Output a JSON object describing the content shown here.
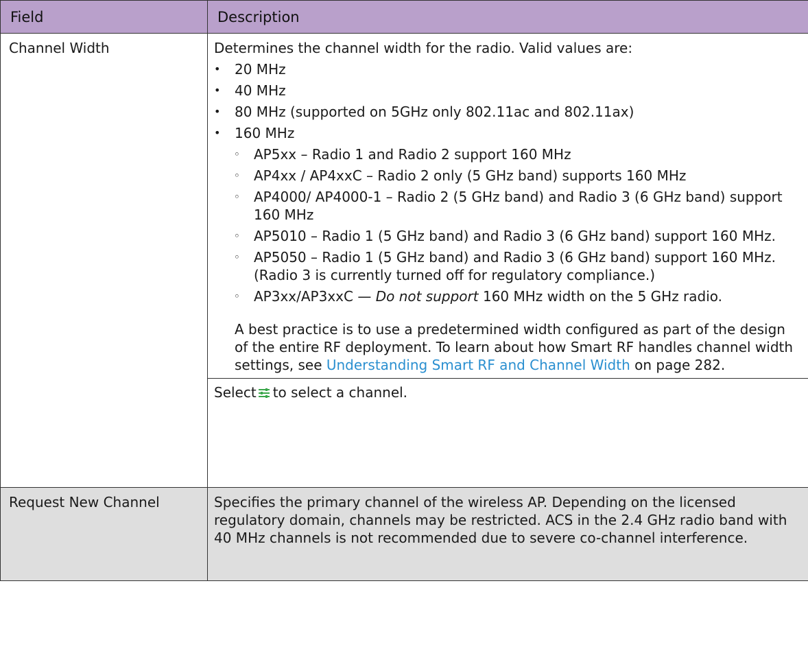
{
  "table": {
    "headers": {
      "field": "Field",
      "description": "Description"
    },
    "row1": {
      "field": "Channel Width",
      "intro": "Determines the channel width for the radio. Valid values are:",
      "bullets": [
        "20 MHz",
        "40 MHz",
        "80 MHz (supported on 5GHz only 802.11ac and 802.11ax)",
        "160 MHz"
      ],
      "sub_bullets": [
        "AP5xx – Radio 1 and Radio 2 support 160 MHz",
        "AP4xx / AP4xxC – Radio 2 only (5 GHz band) supports 160 MHz",
        "AP4000/ AP4000-1 – Radio 2 (5 GHz band) and Radio 3 (6 GHz band) support 160 MHz",
        "AP5010 – Radio 1 (5 GHz band) and Radio 3 (6 GHz band) support 160 MHz.",
        "AP5050 – Radio 1 (5 GHz band) and Radio 3 (6 GHz band) support 160 MHz. (Radio 3 is currently turned off for regulatory compliance.)"
      ],
      "last_sub_bullet": {
        "prefix": "AP3xx/AP3xxC — ",
        "emphasis": "Do not support",
        "suffix": " 160 MHz width on the 5 GHz radio."
      },
      "best_practice": "A best practice is to use a predetermined width configured as part of the design of the entire RF deployment. To learn about how Smart RF handles channel width settings, see ",
      "link_text": "Understanding Smart RF and Channel Width",
      "page_ref": " on page 282.",
      "select_prefix": "Select",
      "select_suffix": "to select a channel.",
      "select_icon": "channel-select-icon",
      "icon_color": "#3aa64a"
    },
    "row2": {
      "field": "Request New Channel",
      "description": "Specifies the primary channel of the wireless AP. Depending on the licensed regulatory domain, channels may be restricted. ACS in the 2.4 GHz radio band with 40 MHz channels is not recommended due to severe co-channel interference."
    }
  },
  "colors": {
    "header_bg": "#b9a0cb",
    "row2_bg": "#dedede",
    "link": "#2a8fd0"
  }
}
